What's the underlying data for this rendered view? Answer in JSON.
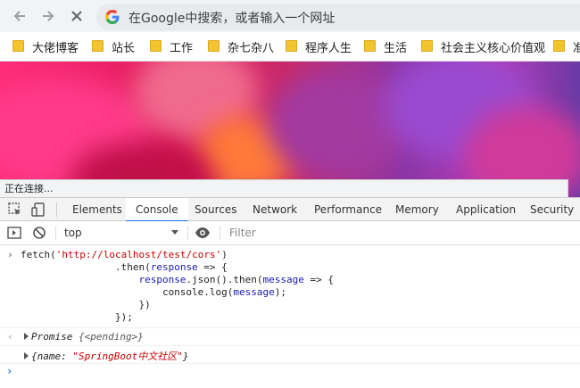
{
  "browser": {
    "omnibox_placeholder": "在Google中搜索，或者输入一个网址",
    "status_text": "正在连接..."
  },
  "bookmarks": [
    {
      "label": "大佬博客"
    },
    {
      "label": "站长"
    },
    {
      "label": "工作"
    },
    {
      "label": "杂七杂八"
    },
    {
      "label": "程序人生"
    },
    {
      "label": "生活"
    },
    {
      "label": "社会主义核心价值观"
    },
    {
      "label": "准"
    }
  ],
  "devtools": {
    "tabs": [
      "Elements",
      "Console",
      "Sources",
      "Network",
      "Performance",
      "Memory",
      "Application",
      "Security"
    ],
    "active_tab": "Console",
    "context": "top",
    "filter_placeholder": "Filter"
  },
  "console": {
    "code_lines": [
      "fetch('http://localhost/test/cors')",
      "                .then(response => {",
      "                    response.json().then(message => {",
      "                        console.log(message);",
      "                    })",
      "                });"
    ],
    "result_promise_prefix": "Promise ",
    "result_promise_state": "{<pending>}",
    "result_object_key": "{name: ",
    "result_object_value": "\"SpringBoot中文社区\"",
    "result_object_close": "}"
  },
  "colors": {
    "accent": "#1a73e8",
    "string": "#c80000",
    "folder": "#f4c430"
  }
}
